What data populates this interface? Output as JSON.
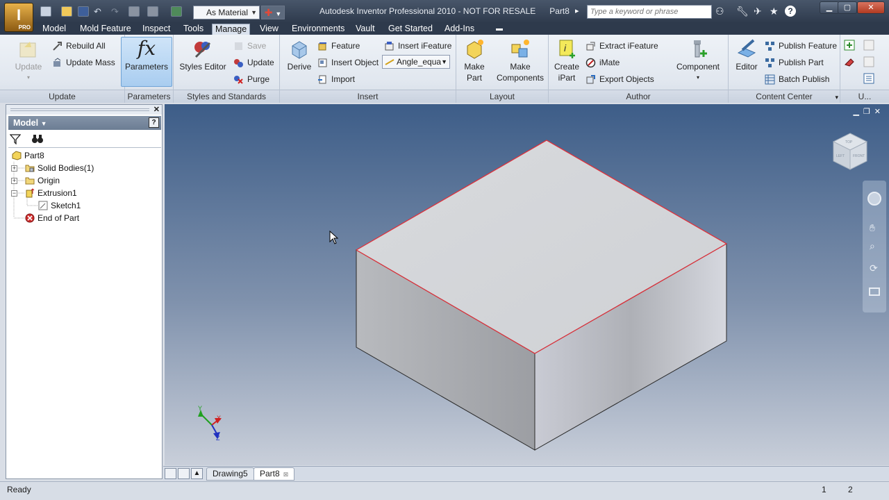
{
  "app": {
    "title": "Autodesk Inventor Professional 2010 - NOT FOR RESALE      Part8",
    "logo_label": "PRO",
    "material": "As Material",
    "search_placeholder": "Type a keyword or phrase"
  },
  "menu": {
    "tabs": [
      "Model",
      "Mold Feature",
      "Inspect",
      "Tools",
      "Manage",
      "View",
      "Environments",
      "Vault",
      "Get Started",
      "Add-Ins"
    ],
    "active": "Manage"
  },
  "ribbon": {
    "update": {
      "label": "Update",
      "update_btn": "Update",
      "rebuild_all": "Rebuild All",
      "update_mass": "Update Mass"
    },
    "parameters": {
      "label": "Parameters",
      "parameters_btn": "Parameters"
    },
    "styles": {
      "label": "Styles and Standards",
      "styles_editor": "Styles Editor",
      "save": "Save",
      "update": "Update",
      "purge": "Purge"
    },
    "insert": {
      "label": "Insert",
      "derive": "Derive",
      "feature": "Feature",
      "insert_object": "Insert Object",
      "import": "Import",
      "insert_ifeature": "Insert iFeature",
      "angle_dropdown": "Angle_equa"
    },
    "layout": {
      "label": "Layout",
      "make_part_1": "Make",
      "make_part_2": "Part",
      "make_components_1": "Make",
      "make_components_2": "Components"
    },
    "author": {
      "label": "Author",
      "create_ipart_1": "Create",
      "create_ipart_2": "iPart",
      "extract_ifeature": "Extract iFeature",
      "imate": "iMate",
      "export_objects": "Export Objects",
      "component": "Component"
    },
    "content_center": {
      "label": "Content Center",
      "editor": "Editor",
      "publish_feature": "Publish Feature",
      "publish_part": "Publish Part",
      "batch_publish": "Batch Publish"
    },
    "overflow_label": "U..."
  },
  "browser": {
    "header": "Model",
    "help": "?",
    "tree": [
      {
        "label": "Part8"
      },
      {
        "label": "Solid Bodies(1)"
      },
      {
        "label": "Origin"
      },
      {
        "label": "Extrusion1"
      },
      {
        "label": "Sketch1"
      },
      {
        "label": "End of Part"
      }
    ]
  },
  "viewport": {
    "axis_x": "X",
    "axis_y": "Y",
    "axis_z": "Z",
    "viewcube_top": "TOP",
    "viewcube_left": "LEFT",
    "viewcube_front": "FRONT"
  },
  "doc_tabs": [
    {
      "label": "Drawing5",
      "active": false
    },
    {
      "label": "Part8",
      "active": true
    }
  ],
  "status": {
    "text": "Ready",
    "num1": "1",
    "num2": "2"
  },
  "colors": {
    "accent": "#6ea3d6",
    "selected_edge": "#e0303a",
    "title_bg": "#2e3a4c"
  }
}
